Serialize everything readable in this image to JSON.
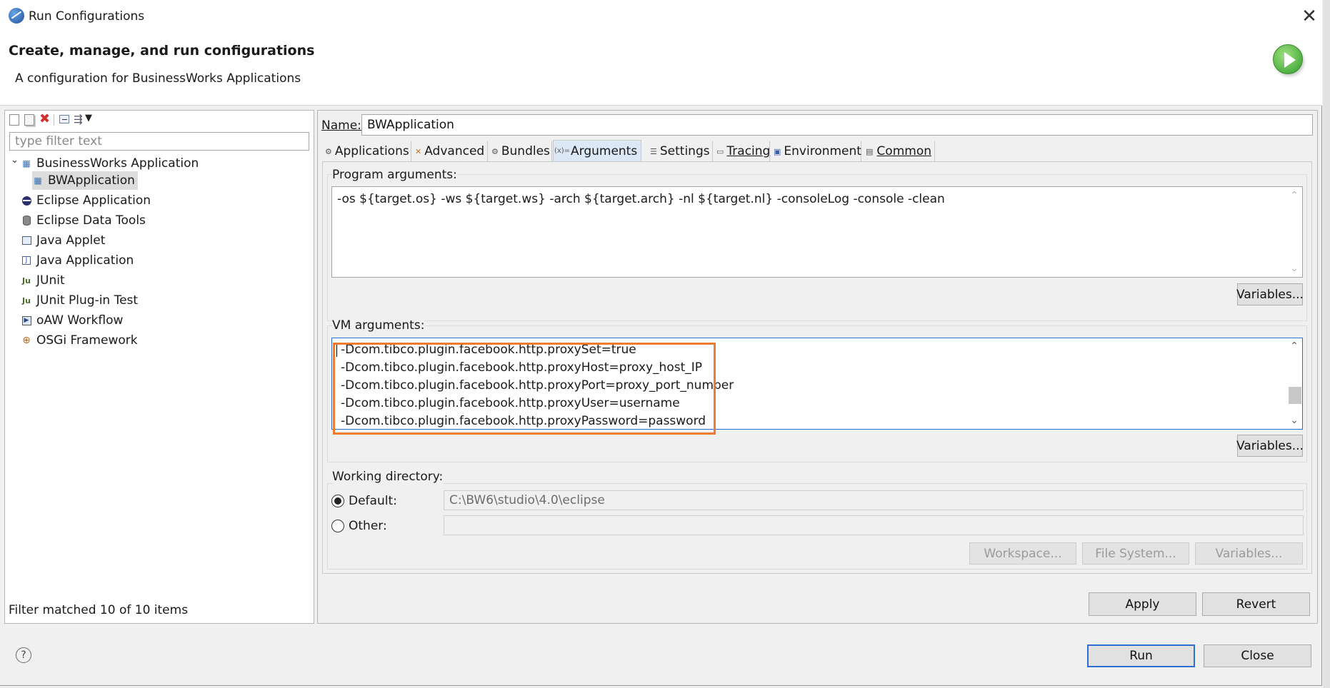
{
  "window": {
    "title": "Run Configurations"
  },
  "header": {
    "title": "Create, manage, and run configurations",
    "subtitle": "A configuration for BusinessWorks Applications"
  },
  "sidebar": {
    "filter_placeholder": "type filter text",
    "items": [
      {
        "label": "BusinessWorks Application",
        "icon": "bw-icon",
        "expanded": true
      },
      {
        "label": "BWApplication",
        "icon": "bw-config-icon",
        "selected": true
      },
      {
        "label": "Eclipse Application",
        "icon": "eclipse-icon"
      },
      {
        "label": "Eclipse Data Tools",
        "icon": "database-icon"
      },
      {
        "label": "Java Applet",
        "icon": "applet-icon"
      },
      {
        "label": "Java Application",
        "icon": "java-app-icon"
      },
      {
        "label": "JUnit",
        "icon": "junit-icon"
      },
      {
        "label": "JUnit Plug-in Test",
        "icon": "junit-plugin-icon"
      },
      {
        "label": "oAW Workflow",
        "icon": "workflow-icon"
      },
      {
        "label": "OSGi Framework",
        "icon": "osgi-icon"
      }
    ],
    "status": "Filter matched 10 of 10 items"
  },
  "main": {
    "name_label": "Name:",
    "name_value": "BWApplication",
    "tabs": [
      {
        "label": "Applications",
        "icon": "applications-icon"
      },
      {
        "label": "Advanced",
        "icon": "advanced-icon"
      },
      {
        "label": "Bundles",
        "icon": "bundles-icon"
      },
      {
        "label": "Arguments",
        "icon": "arguments-icon",
        "active": true
      },
      {
        "label": "Settings",
        "icon": "settings-icon"
      },
      {
        "label": "Tracing",
        "icon": "tracing-icon"
      },
      {
        "label": "Environment",
        "icon": "environment-icon"
      },
      {
        "label": "Common",
        "icon": "common-icon"
      }
    ],
    "program_args": {
      "label": "Program arguments:",
      "value": "-os ${target.os} -ws ${target.ws} -arch ${target.arch} -nl ${target.nl} -consoleLog -console -clean",
      "variables_button": "Variables..."
    },
    "vm_args": {
      "label": "VM arguments:",
      "lines": [
        "-Dcom.tibco.plugin.facebook.http.proxySet=true",
        "-Dcom.tibco.plugin.facebook.http.proxyHost=proxy_host_IP",
        "-Dcom.tibco.plugin.facebook.http.proxyPort=proxy_port_number",
        "-Dcom.tibco.plugin.facebook.http.proxyUser=username",
        "-Dcom.tibco.plugin.facebook.http.proxyPassword=password"
      ],
      "variables_button": "Variables...",
      "highlight_color": "#ee7d31"
    },
    "working_dir": {
      "label": "Working directory:",
      "default_label": "Default:",
      "default_value": "C:\\BW6\\studio\\4.0\\eclipse",
      "other_label": "Other:",
      "other_value": "",
      "workspace_button": "Workspace...",
      "filesystem_button": "File System...",
      "variables_button": "Variables..."
    },
    "apply_button": "Apply",
    "revert_button": "Revert"
  },
  "footer": {
    "run_button": "Run",
    "close_button": "Close"
  },
  "colors": {
    "accent": "#2f6fd1",
    "highlight": "#ee7d31",
    "selection": "#dde8f6"
  }
}
